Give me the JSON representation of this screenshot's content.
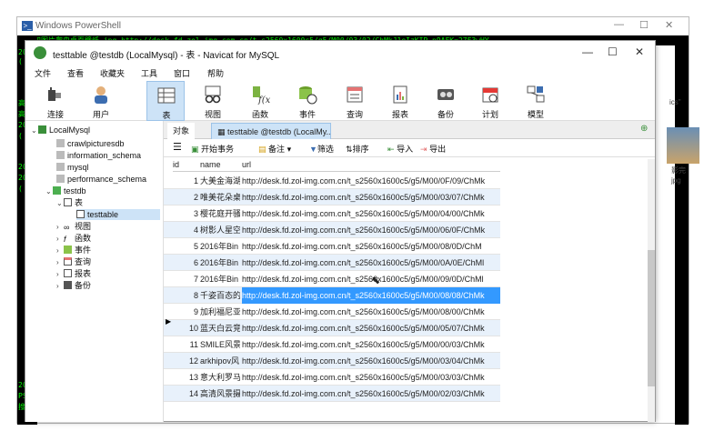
{
  "bg_window": {
    "title": "Windows PowerShell",
    "icon": "powershell-icon",
    "cmdline": "意主和图片爬虫桌面壁纸.jpg http://desk.fd.zol-img.com.cn/t_s2560x1600c5/g5/M00/03/02/ChMkJ1eIzKIP n9AFK=27F3wHY",
    "side_text": [
      "20",
      "(",
      "高",
      "高",
      "20",
      "(",
      "20",
      "20",
      "(",
      "20",
      "PS",
      "搜"
    ],
    "right_strip": [
      "ics\"",
      "影完",
      "jpg"
    ]
  },
  "window": {
    "title": "testtable @testdb (LocalMysql) - 表 - Navicat for MySQL",
    "min": "—",
    "max": "☐",
    "close": "✕"
  },
  "menu": [
    "文件",
    "查看",
    "收藏夹",
    "工具",
    "窗口",
    "帮助"
  ],
  "toolbar": [
    {
      "label": "连接",
      "icon": "connection-icon"
    },
    {
      "label": "用户",
      "icon": "user-icon"
    },
    {
      "label": "表",
      "icon": "table-icon"
    },
    {
      "label": "视图",
      "icon": "view-icon"
    },
    {
      "label": "函数",
      "icon": "function-icon"
    },
    {
      "label": "事件",
      "icon": "event-icon"
    },
    {
      "label": "查询",
      "icon": "query-icon"
    },
    {
      "label": "报表",
      "icon": "report-icon"
    },
    {
      "label": "备份",
      "icon": "backup-icon"
    },
    {
      "label": "计划",
      "icon": "schedule-icon"
    },
    {
      "label": "模型",
      "icon": "model-icon"
    }
  ],
  "tree": {
    "connection": "LocalMysql",
    "databases": [
      "crawlpicturesdb",
      "information_schema",
      "mysql",
      "performance_schema"
    ],
    "current_db": "testdb",
    "tables_folder": "表",
    "table": "testtable",
    "folders": [
      "视图",
      "函数",
      "事件",
      "查询",
      "报表",
      "备份"
    ]
  },
  "tabs": {
    "objects": "对象",
    "table_tab": "testtable @testdb (LocalMy..."
  },
  "grid_toolbar": {
    "begin_tx": "开始事务",
    "note": "备注",
    "filter": "筛选",
    "sort": "排序",
    "import": "导入",
    "export": "导出"
  },
  "columns": [
    "id",
    "name",
    "url"
  ],
  "rows": [
    {
      "id": "1",
      "name": "大美金海湖",
      "url": "http://desk.fd.zol-img.com.cn/t_s2560x1600c5/g5/M00/0F/09/ChMk"
    },
    {
      "id": "2",
      "name": "唯美花朵桌",
      "url": "http://desk.fd.zol-img.com.cn/t_s2560x1600c5/g5/M00/03/07/ChMk"
    },
    {
      "id": "3",
      "name": "樱花庭开骚",
      "url": "http://desk.fd.zol-img.com.cn/t_s2560x1600c5/g5/M00/04/00/ChMk"
    },
    {
      "id": "4",
      "name": "树影人星空",
      "url": "http://desk.fd.zol-img.com.cn/t_s2560x1600c5/g5/M00/06/0F/ChMk"
    },
    {
      "id": "5",
      "name": "2016年Bin",
      "url": "http://desk.fd.zol-img.com.cn/t_s2560x1600c5/g5/M00/08/0D/ChM"
    },
    {
      "id": "6",
      "name": "2016年Bin",
      "url": "http://desk.fd.zol-img.com.cn/t_s2560x1600c5/g5/M00/0A/0E/ChMl"
    },
    {
      "id": "7",
      "name": "2016年Bin",
      "url": "http://desk.fd.zol-img.com.cn/t_s2560x1600c5/g5/M00/09/0D/ChMl"
    },
    {
      "id": "8",
      "name": "千姿百态的",
      "url": "http://desk.fd.zol-img.com.cn/t_s2560x1600c5/g5/M00/08/08/ChMk"
    },
    {
      "id": "9",
      "name": "加利福尼亚",
      "url": "http://desk.fd.zol-img.com.cn/t_s2560x1600c5/g5/M00/08/00/ChMk"
    },
    {
      "id": "10",
      "name": "蓝天白云竞",
      "url": "http://desk.fd.zol-img.com.cn/t_s2560x1600c5/g5/M00/05/07/ChMk"
    },
    {
      "id": "11",
      "name": "SMILE风景",
      "url": "http://desk.fd.zol-img.com.cn/t_s2560x1600c5/g5/M00/00/03/ChMk"
    },
    {
      "id": "12",
      "name": "arkhipov风",
      "url": "http://desk.fd.zol-img.com.cn/t_s2560x1600c5/g5/M00/03/04/ChMk"
    },
    {
      "id": "13",
      "name": "意大利罗马",
      "url": "http://desk.fd.zol-img.com.cn/t_s2560x1600c5/g5/M00/03/03/ChMk"
    },
    {
      "id": "14",
      "name": "高清风景摄",
      "url": "http://desk.fd.zol-img.com.cn/t_s2560x1600c5/g5/M00/02/03/ChMk"
    }
  ],
  "selected_row": "8",
  "colors": {
    "selection": "#3399ff",
    "active_tab": "#cde3f7",
    "alt_row": "#e8f1fb"
  }
}
